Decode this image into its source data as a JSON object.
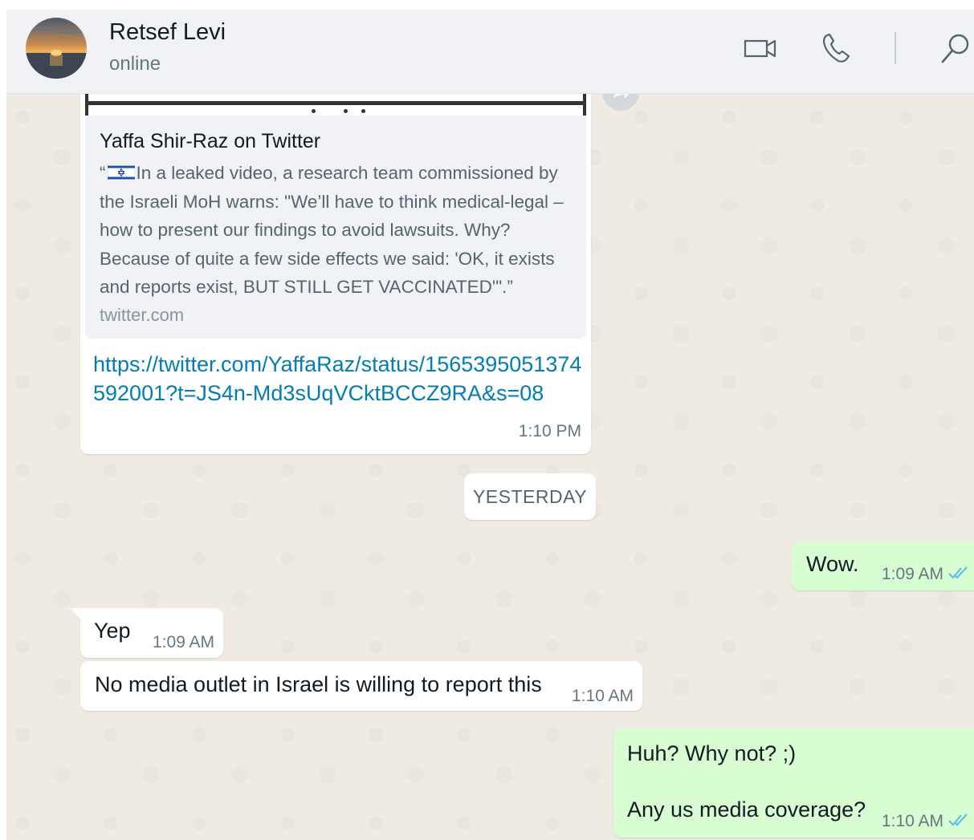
{
  "header": {
    "contact_name": "Retsef Levi",
    "status": "online",
    "icons": [
      "video-call-icon",
      "voice-call-icon",
      "search-icon"
    ]
  },
  "messages": {
    "link_preview": {
      "title": "Yaffa Shir-Raz on Twitter",
      "desc_open": "“",
      "flag_icon": "israel-flag-emoji",
      "description": "In a leaked video, a research team commissioned by the Israeli MoH warns: \"We’ll have to think medical-legal – how to present our findings to avoid lawsuits. Why? Because of quite a few side effects we said: 'OK, it exists and reports exist, BUT STILL GET VACCINATED'\".”",
      "domain": "twitter.com",
      "url": "https://twitter.com/YaffaRaz/status/1565395051374592001?t=JS4n-Md3sUqVCktBCCZ9RA&s=08",
      "time": "1:10 PM"
    },
    "date_separator": "YESTERDAY",
    "wow": {
      "text": "Wow.",
      "time": "1:09 AM"
    },
    "yep": {
      "text": "Yep",
      "time": "1:09 AM"
    },
    "no_media": {
      "text": "No media outlet in Israel is willing to report this",
      "time": "1:10 AM"
    },
    "huh": {
      "line1": "Huh? Why not? ;)",
      "line2": "Any us media coverage?",
      "time": "1:10 AM"
    }
  },
  "colors": {
    "chat_bg": "#efeae2",
    "incoming_bubble": "#ffffff",
    "outgoing_bubble": "#d9fdd3",
    "link": "#027eb5",
    "read_ticks": "#53bdeb"
  }
}
